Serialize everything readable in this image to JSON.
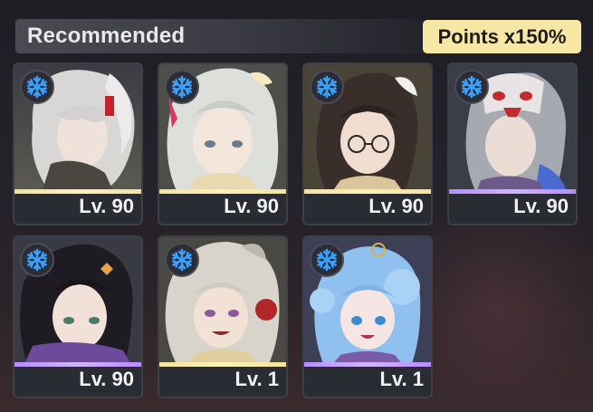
{
  "header": {
    "title": "Recommended",
    "points_label": "Points x150%"
  },
  "element_icon": "snowflake-icon",
  "colors": {
    "gold_rarity": "#f4e39a",
    "purple_rarity": "#b88bff",
    "points_badge": "#f7e7a4",
    "ice_icon": "#3aa0ff"
  },
  "characters": [
    {
      "level": "Lv. 90",
      "rarity": "gold",
      "portrait": "white-haired-character"
    },
    {
      "level": "Lv. 90",
      "rarity": "gold",
      "portrait": "silver-haired-character"
    },
    {
      "level": "Lv. 90",
      "rarity": "gold",
      "portrait": "dark-haired-glasses-character"
    },
    {
      "level": "Lv. 90",
      "rarity": "purple",
      "portrait": "masked-character"
    },
    {
      "level": "Lv. 90",
      "rarity": "purple",
      "portrait": "black-haired-character"
    },
    {
      "level": "Lv. 1",
      "rarity": "gold",
      "portrait": "fluffy-haired-character"
    },
    {
      "level": "Lv. 1",
      "rarity": "purple",
      "portrait": "blue-haired-character"
    }
  ]
}
